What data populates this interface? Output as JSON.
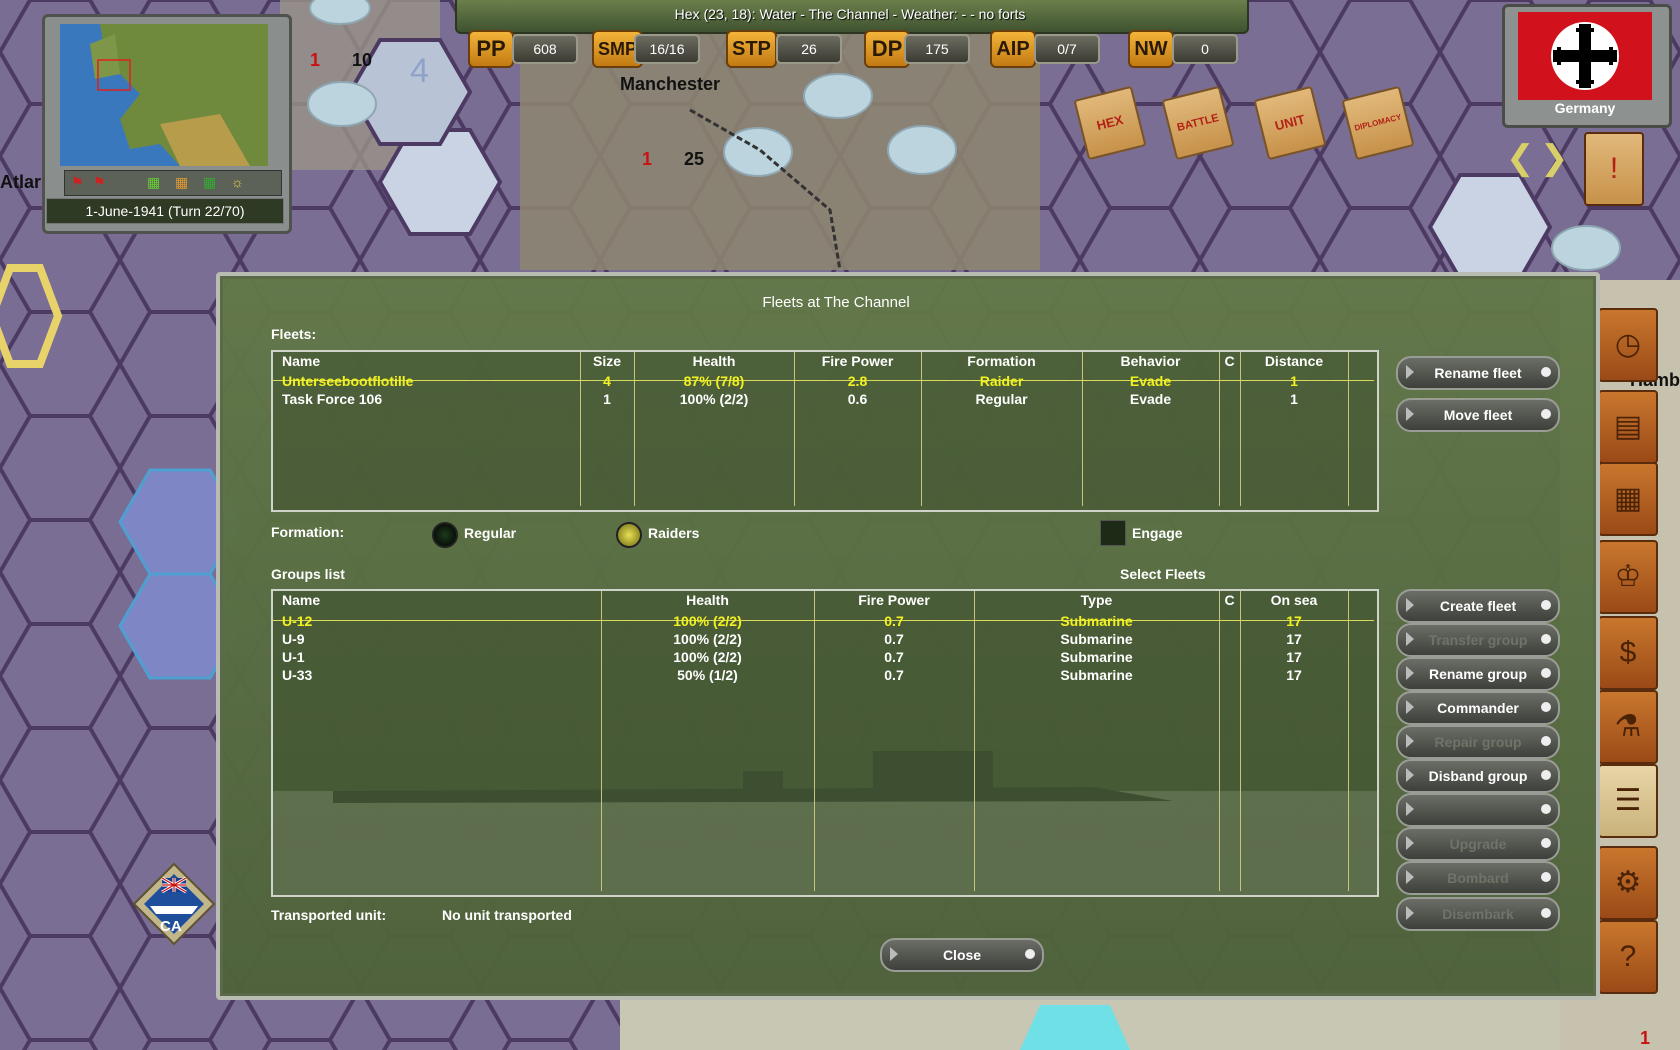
{
  "top_bar": {
    "hex_info": "Hex (23, 18): Water - The Channel - Weather: - - no forts",
    "resources": [
      {
        "key": "PP",
        "value": "608"
      },
      {
        "key": "SMP",
        "value": "16/16"
      },
      {
        "key": "STP",
        "value": "26"
      },
      {
        "key": "DP",
        "value": "175"
      },
      {
        "key": "AIP",
        "value": "0/7"
      },
      {
        "key": "NW",
        "value": "0"
      }
    ]
  },
  "minimap": {
    "date": "1-June-1941 (Turn 22/70)"
  },
  "map_labels": {
    "atlantic": "Atlar",
    "manchester": "Manchester",
    "hamburg": "Hamb",
    "city_num1": "1",
    "city_num2": "10",
    "city_num3": "25",
    "hex_num": "4",
    "corner_1": "1",
    "corner_10": "10"
  },
  "action_buttons": [
    "HEX",
    "BATTLE",
    "UNIT",
    "DIPLOMACY"
  ],
  "nation": {
    "name": "Germany",
    "flag_color": "#d1111b"
  },
  "naval_counter": {
    "type": "CA"
  },
  "dialog": {
    "title": "Fleets at The Channel",
    "fleets_label": "Fleets:",
    "fleet_columns": [
      "Name",
      "Size",
      "Health",
      "Fire Power",
      "Formation",
      "Behavior",
      "C",
      "Distance"
    ],
    "fleets": [
      {
        "name": "Unterseebootflotille",
        "size": "4",
        "health": "87% (7/8)",
        "fire_power": "2.8",
        "formation": "Raider",
        "behavior": "Evade",
        "c": "",
        "distance": "1"
      },
      {
        "name": "Task Force 106",
        "size": "1",
        "health": "100% (2/2)",
        "fire_power": "0.6",
        "formation": "Regular",
        "behavior": "Evade",
        "c": "",
        "distance": "1"
      }
    ],
    "formation_label": "Formation:",
    "formation_regular": "Regular",
    "formation_raiders": "Raiders",
    "engage_label": "Engage",
    "groups_label": "Groups list",
    "select_fleets_label": "Select Fleets",
    "group_columns": [
      "Name",
      "Health",
      "Fire Power",
      "Type",
      "C",
      "On sea"
    ],
    "groups": [
      {
        "name": "U-12",
        "health": "100% (2/2)",
        "fire_power": "0.7",
        "type": "Submarine",
        "c": "",
        "on_sea": "17"
      },
      {
        "name": "U-9",
        "health": "100% (2/2)",
        "fire_power": "0.7",
        "type": "Submarine",
        "c": "",
        "on_sea": "17"
      },
      {
        "name": "U-1",
        "health": "100% (2/2)",
        "fire_power": "0.7",
        "type": "Submarine",
        "c": "",
        "on_sea": "17"
      },
      {
        "name": "U-33",
        "health": "50% (1/2)",
        "fire_power": "0.7",
        "type": "Submarine",
        "c": "",
        "on_sea": "17"
      }
    ],
    "transported_label": "Transported unit:",
    "transported_value": "No unit transported",
    "fleet_buttons": {
      "rename_fleet": "Rename fleet",
      "move_fleet": "Move fleet"
    },
    "group_buttons": {
      "create_fleet": "Create fleet",
      "transfer_group": "Transfer group",
      "rename_group": "Rename group",
      "commander": "Commander",
      "repair_group": "Repair group",
      "disband_group": "Disband group",
      "blank1": "",
      "upgrade": "Upgrade",
      "bombard": "Bombard",
      "blank2": "Disembark"
    },
    "close_button": "Close"
  }
}
